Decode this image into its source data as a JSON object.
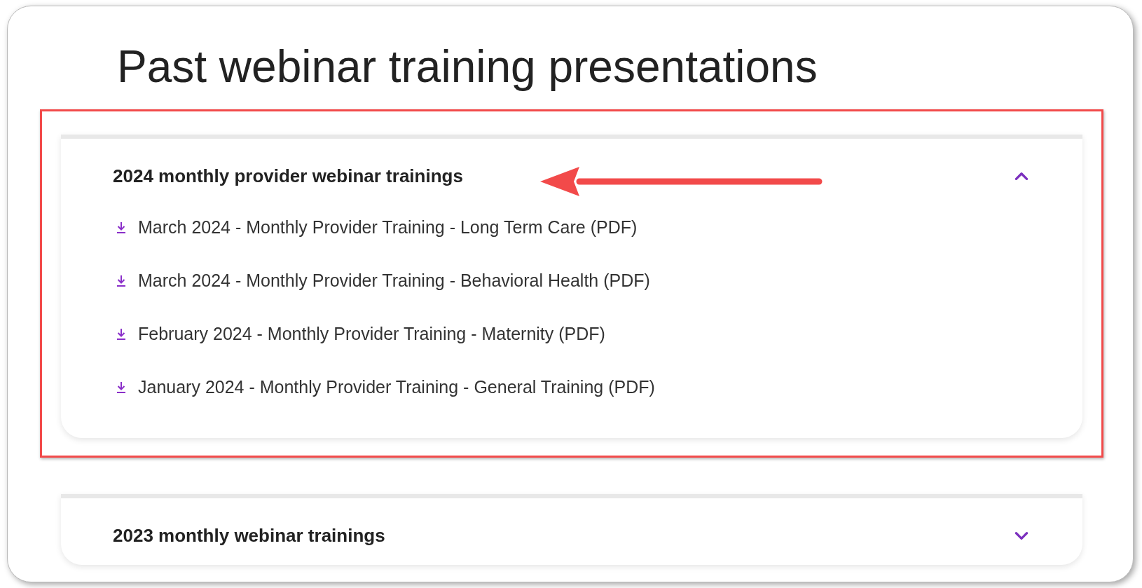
{
  "title": "Past webinar training presentations",
  "sections": [
    {
      "title": "2024 monthly provider webinar trainings",
      "expanded": true,
      "highlighted": true,
      "items": [
        "March 2024 - Monthly Provider Training - Long Term Care (PDF)",
        "March 2024 - Monthly Provider Training - Behavioral Health (PDF)",
        "February 2024 - Monthly Provider Training - Maternity (PDF)",
        "January 2024 - Monthly Provider Training - General Training (PDF)"
      ]
    },
    {
      "title": "2023 monthly webinar trainings",
      "expanded": false,
      "highlighted": false
    }
  ]
}
